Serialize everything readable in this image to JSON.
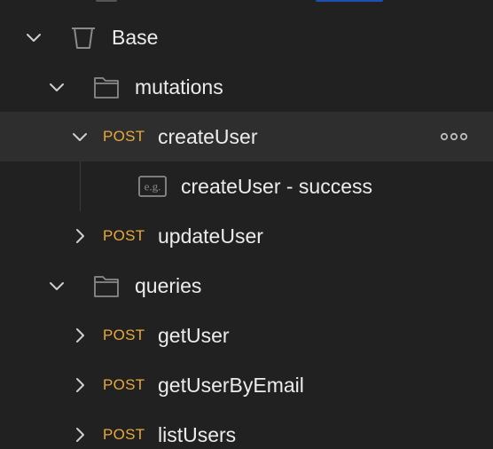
{
  "tree": {
    "collection": {
      "label": "Base",
      "icon": "trash-bin-icon"
    },
    "folders": [
      {
        "label": "mutations",
        "requests": [
          {
            "method": "POST",
            "label": "createUser",
            "selected": true,
            "expanded": true,
            "examples": [
              {
                "badge": "e.g.",
                "label": "createUser - success"
              }
            ]
          },
          {
            "method": "POST",
            "label": "updateUser"
          }
        ]
      },
      {
        "label": "queries",
        "requests": [
          {
            "method": "POST",
            "label": "getUser"
          },
          {
            "method": "POST",
            "label": "getUserByEmail"
          },
          {
            "method": "POST",
            "label": "listUsers"
          }
        ]
      }
    ]
  },
  "colors": {
    "background": "#212121",
    "selected_row": "#2e2e2e",
    "method_post": "#e8a93b",
    "text": "#ececec",
    "icon": "#8a8a8a"
  }
}
